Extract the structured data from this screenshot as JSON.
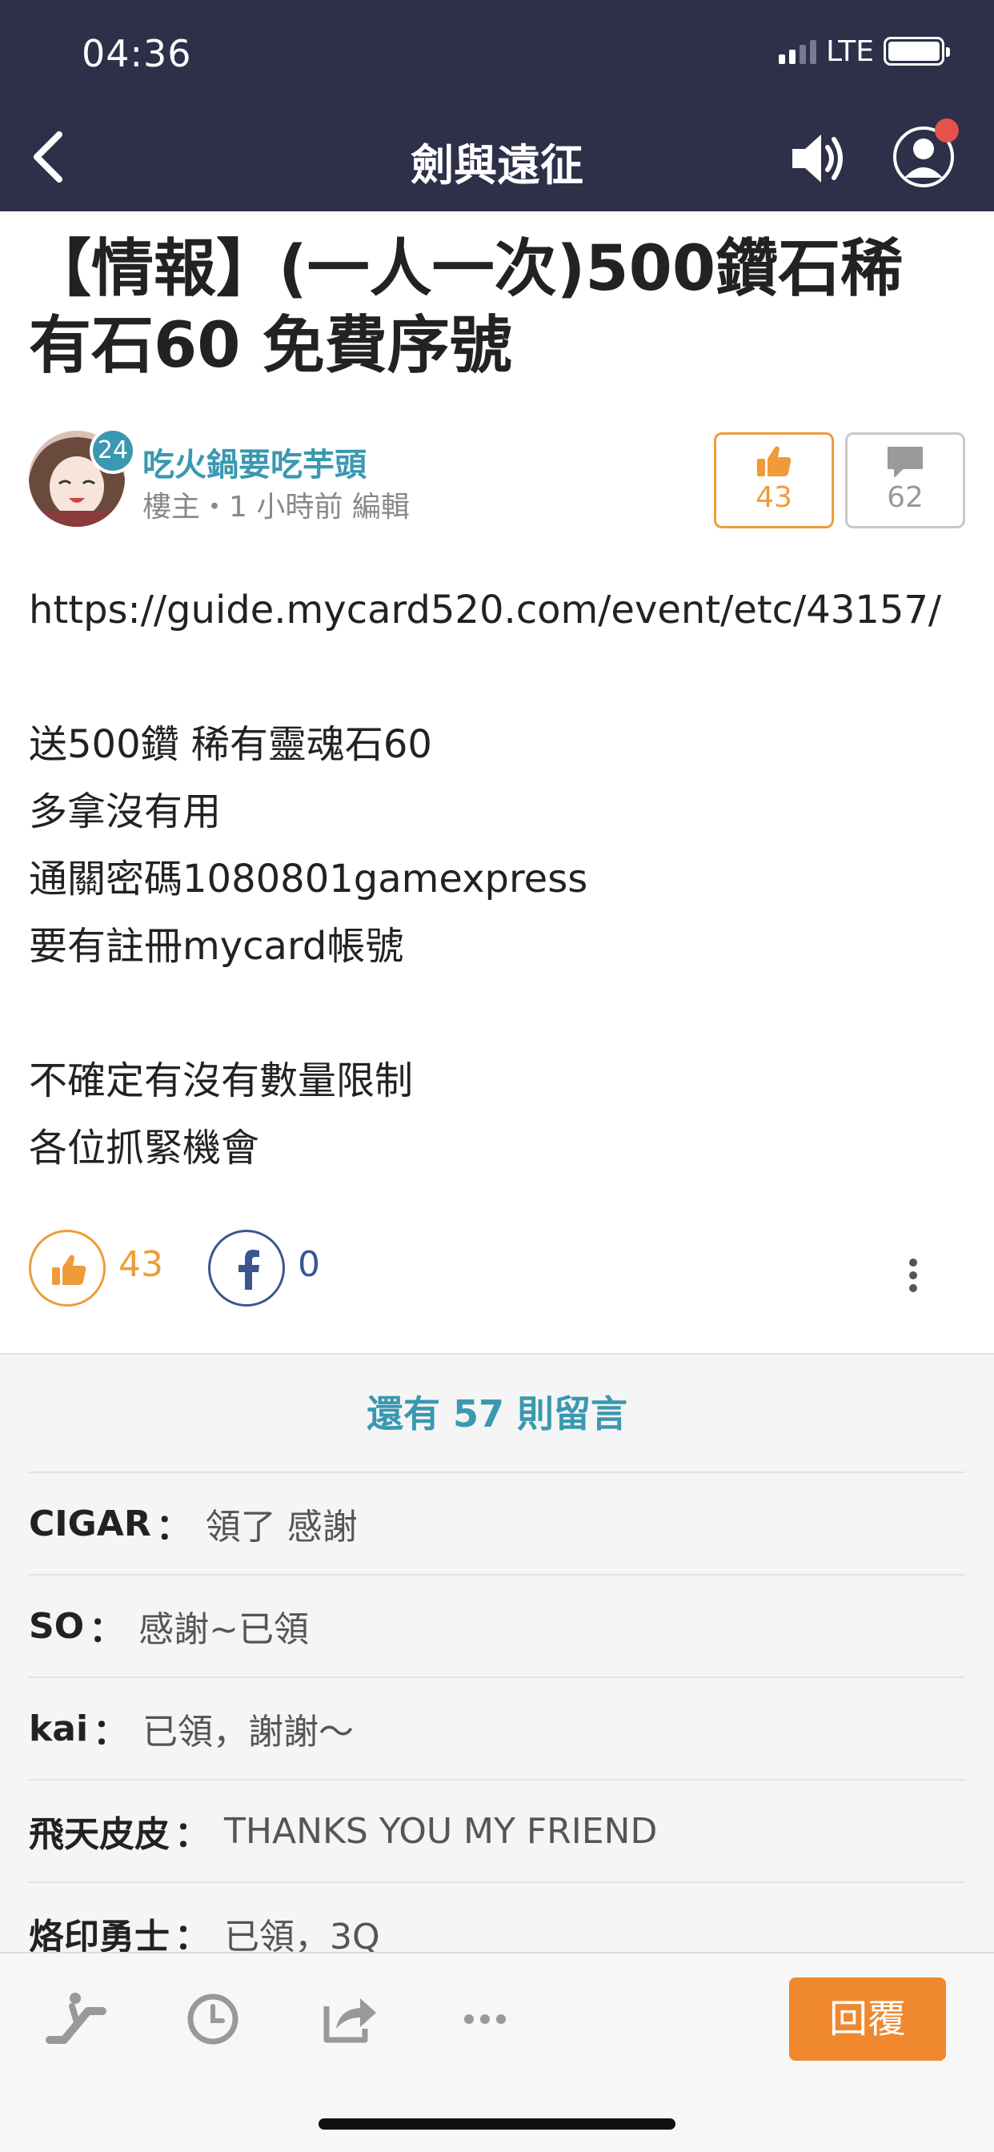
{
  "status_bar": {
    "time": "04:36",
    "network": "LTE"
  },
  "nav": {
    "title": "劍與遠征"
  },
  "post": {
    "title": "【情報】(一人一次)500鑽石稀有石60 免費序號",
    "author": {
      "name": "吃火鍋要吃芋頭",
      "level": "24",
      "meta": "樓主・1 小時前 編輯"
    },
    "likes": "43",
    "comments": "62",
    "content_lines": [
      "https://guide.mycard520.com/event/etc/43157/",
      "",
      "送500鑽 稀有靈魂石60",
      "多拿沒有用",
      "通關密碼1080801gamexpress",
      "要有註冊mycard帳號",
      "",
      "不確定有沒有數量限制",
      "各位抓緊機會"
    ],
    "action_likes": "43",
    "facebook_shares": "0"
  },
  "comments_section": {
    "more_label": "還有 57 則留言",
    "items": [
      {
        "name": "CIGAR",
        "sep": "：",
        "text": "領了 感謝"
      },
      {
        "name": "SO",
        "sep": "：",
        "text": "感謝~已領"
      },
      {
        "name": "kai",
        "sep": "：",
        "text": "已領，謝謝～"
      },
      {
        "name": "飛天皮皮",
        "sep": "：",
        "text": "THANKS YOU MY FRIEND"
      },
      {
        "name": "烙印勇士",
        "sep": "：",
        "text": "已領，3Q"
      }
    ]
  },
  "toolbar": {
    "reply_label": "回覆"
  },
  "colors": {
    "header_bg": "#2e2f49",
    "accent_blue": "#3a98b0",
    "accent_orange": "#f09b3a",
    "reply_orange": "#f0882f",
    "facebook_blue": "#3b5590"
  },
  "icons": [
    "back-icon",
    "speaker-icon",
    "profile-icon",
    "thumbs-up-icon",
    "comment-icon",
    "facebook-icon",
    "more-vertical-icon",
    "escalator-icon",
    "clock-icon",
    "share-icon",
    "more-horizontal-icon"
  ]
}
